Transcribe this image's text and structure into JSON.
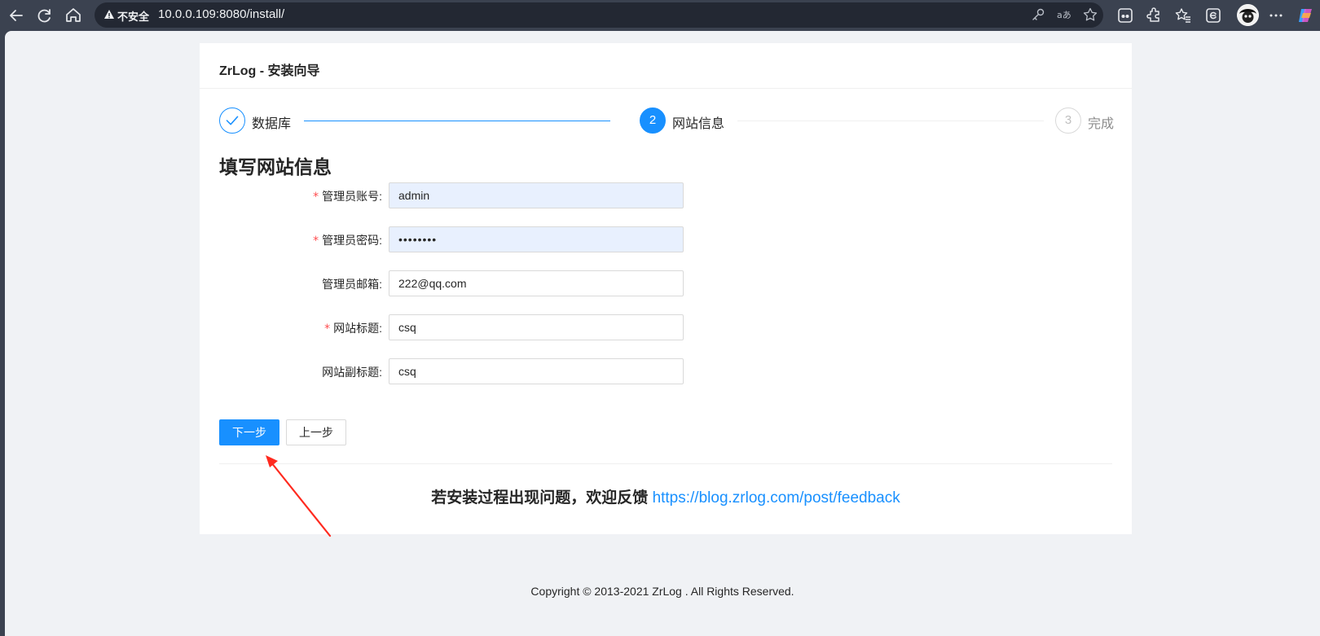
{
  "browser": {
    "security_label": "不安全",
    "url": "10.0.0.109:8080/install/"
  },
  "card": {
    "title": "ZrLog - 安装向导"
  },
  "steps": [
    {
      "number": "1",
      "label": "数据库",
      "status": "finished"
    },
    {
      "number": "2",
      "label": "网站信息",
      "status": "process"
    },
    {
      "number": "3",
      "label": "完成",
      "status": "wait"
    }
  ],
  "form": {
    "title": "填写网站信息",
    "fields": [
      {
        "label": "管理员账号:",
        "required": true,
        "value": "admin",
        "type": "text"
      },
      {
        "label": "管理员密码:",
        "required": true,
        "value": "••••••••",
        "type": "password"
      },
      {
        "label": "管理员邮箱:",
        "required": false,
        "value": "222@qq.com",
        "type": "text"
      },
      {
        "label": "网站标题:",
        "required": true,
        "value": "csq",
        "type": "text"
      },
      {
        "label": "网站副标题:",
        "required": false,
        "value": "csq",
        "type": "text"
      }
    ],
    "required_mark": "*",
    "next_button": "下一步",
    "prev_button": "上一步"
  },
  "feedback": {
    "text": "若安装过程出现问题，欢迎反馈",
    "link": "https://blog.zrlog.com/post/feedback"
  },
  "footer": {
    "copyright": "Copyright © 2013-2021 ZrLog . All Rights Reserved."
  },
  "colors": {
    "primary": "#1890ff",
    "required": "#ff4d4f",
    "annotation_arrow": "#ff2a1f"
  }
}
